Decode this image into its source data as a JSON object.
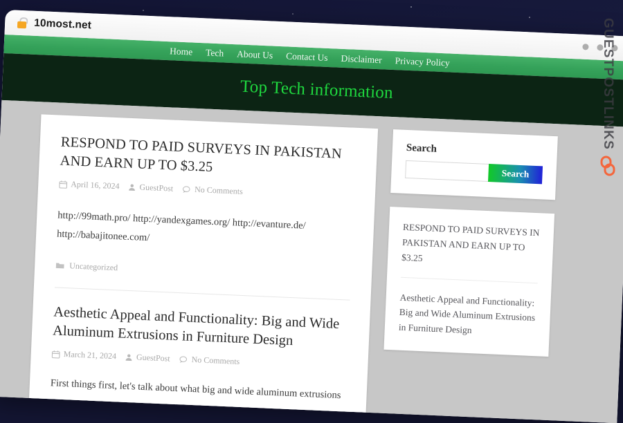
{
  "browser": {
    "url": "10most.net",
    "lock_icon": "lock-icon",
    "window_dots": [
      "dot-1",
      "dot-2",
      "dot-3"
    ]
  },
  "site": {
    "nav": [
      {
        "label": "Home"
      },
      {
        "label": "Tech"
      },
      {
        "label": "About Us"
      },
      {
        "label": "Contact Us"
      },
      {
        "label": "Disclaimer"
      },
      {
        "label": "Privacy Policy"
      }
    ],
    "hero_title": "Top Tech information",
    "colors": {
      "nav_green": "#35a25a",
      "hero_dark_green": "#0c2414",
      "hero_title_green": "#1fd93f",
      "page_grey": "#c7c7c7",
      "search_button_gradient_start": "#12c928",
      "search_button_gradient_end": "#2020d8"
    }
  },
  "posts": [
    {
      "title": "RESPOND TO PAID SURVEYS IN PAKISTAN AND EARN UP TO $3.25",
      "date": "April 16, 2024",
      "author": "GuestPost",
      "comments": "No Comments",
      "body": "http://99math.pro/ http://yandexgames.org/ http://evanture.de/ http://babajitonee.com/",
      "category": "Uncategorized"
    },
    {
      "title": "Aesthetic Appeal and Functionality: Big and Wide Aluminum Extrusions in Furniture Design",
      "date": "March 21, 2024",
      "author": "GuestPost",
      "comments": "No Comments",
      "body": "First things first, let's talk about what big and wide aluminum extrusions"
    }
  ],
  "sidebar": {
    "search": {
      "title": "Search",
      "value": "",
      "placeholder": "",
      "button_label": "Search"
    },
    "recent_posts": [
      {
        "title": "RESPOND TO PAID SURVEYS IN PAKISTAN AND EARN UP TO $3.25"
      },
      {
        "title": "Aesthetic Appeal and Functionality: Big and Wide Aluminum Extrusions in Furniture Design"
      }
    ]
  },
  "watermark": {
    "text": "GUESTPOSTLINKS",
    "logo_icon": "chain-link-icon",
    "logo_color": "#f4663c"
  }
}
